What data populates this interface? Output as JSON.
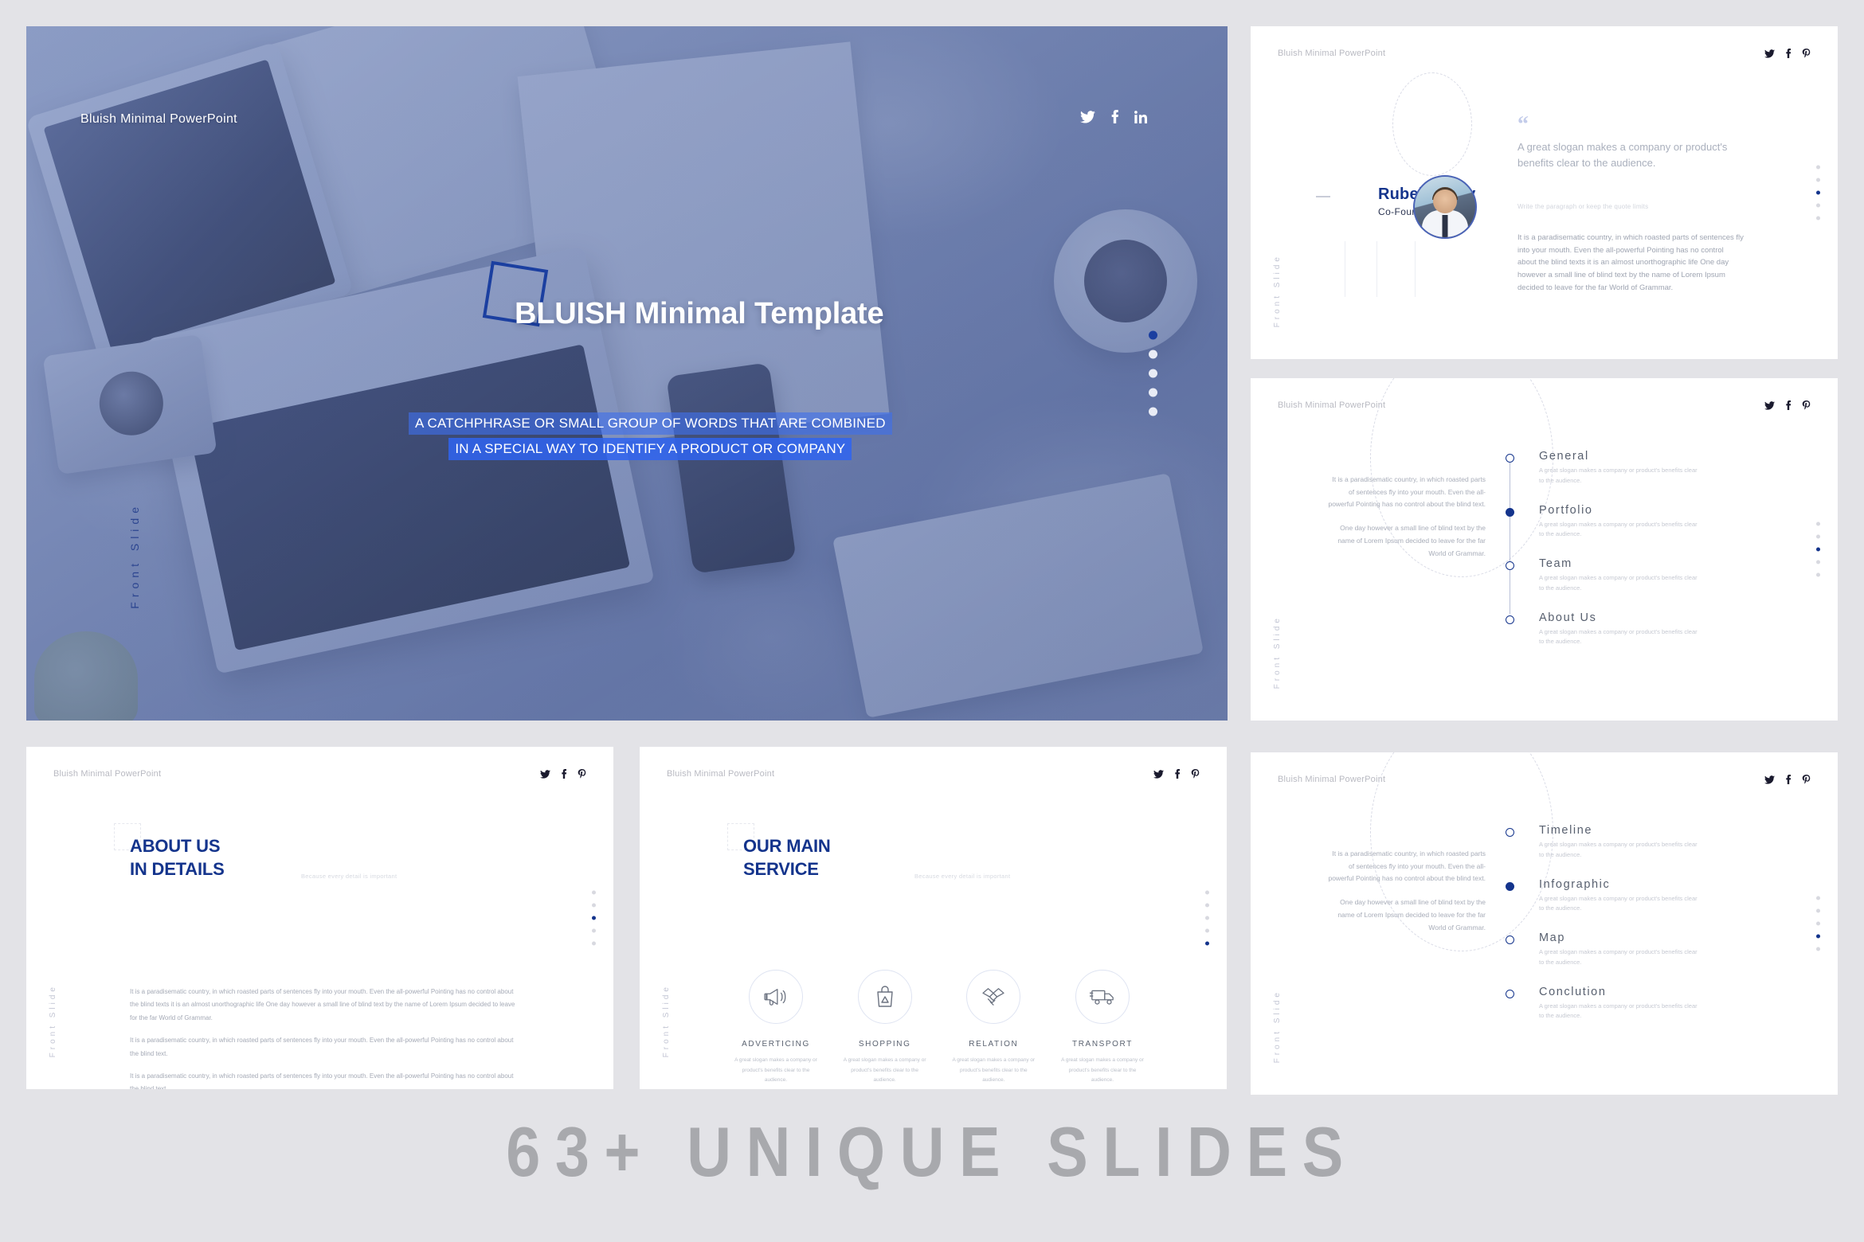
{
  "brand": "Bluish Minimal PowerPoint",
  "colors": {
    "accent": "#14348c",
    "accent_bright": "#1b3fa0",
    "highlight": "#3064f0",
    "page_bg": "#e3e3e7",
    "muted_text": "#a5aab6",
    "footer_text": "#a8a9ad"
  },
  "hero": {
    "brand": "Bluish Minimal PowerPoint",
    "title": "BLUISH Minimal Template",
    "subtitle_line1": "A CATCHPHRASE OR SMALL GROUP OF WORDS THAT ARE COMBINED",
    "subtitle_line2": "IN A SPECIAL WAY TO IDENTIFY A PRODUCT OR COMPANY",
    "side_label": "Front Slide",
    "socials": [
      "twitter-icon",
      "facebook-icon",
      "linkedin-icon"
    ],
    "dots": 5,
    "active_dot": 0
  },
  "slide_quote": {
    "brand": "Bluish Minimal PowerPoint",
    "person_name": "Rubel Mistry",
    "person_role": "Co-Founder, MNSK",
    "quote_mark": "“",
    "quote": "A great slogan makes a company or product's benefits clear to the audience.",
    "small_line": "Write the paragraph or keep the quote limits",
    "body": "It is a paradisematic country, in which roasted parts of sentences fly into your mouth. Even the all-powerful Pointing has no control about the blind texts it is an almost unorthographic life One day however a small line of blind text by the name of Lorem Ipsum decided to leave for the far World of Grammar.",
    "side_label": "Front Slide",
    "dots": 5,
    "active_dot": 2
  },
  "slide_menu_a": {
    "brand": "Bluish Minimal PowerPoint",
    "left_paragraphs": [
      "It is a paradisematic country, in which roasted parts of sentences fly into your mouth. Even the all-powerful Pointing has no control about the blind text.",
      "One day however a small line of blind text by the name of Lorem Ipsum decided to leave for the far World of Grammar."
    ],
    "items": [
      {
        "label": "General",
        "desc": "A great slogan makes a company or product's benefits clear to the audience.",
        "active": false
      },
      {
        "label": "Portfolio",
        "desc": "A great slogan makes a company or product's benefits clear to the audience.",
        "active": true
      },
      {
        "label": "Team",
        "desc": "A great slogan makes a company or product's benefits clear to the audience.",
        "active": false
      },
      {
        "label": "About Us",
        "desc": "A great slogan makes a company or product's benefits clear to the audience.",
        "active": false
      }
    ],
    "side_label": "Front Slide",
    "dots": 5,
    "active_dot": 2
  },
  "slide_menu_b": {
    "brand": "Bluish Minimal PowerPoint",
    "left_paragraphs": [
      "It is a paradisematic country, in which roasted parts of sentences fly into your mouth. Even the all-powerful Pointing has no control about the blind text.",
      "One day however a small line of blind text by the name of Lorem Ipsum decided to leave for the far World of Grammar."
    ],
    "items": [
      {
        "label": "Timeline",
        "desc": "A great slogan makes a company or product's benefits clear to the audience.",
        "active": false
      },
      {
        "label": "Infographic",
        "desc": "A great slogan makes a company or product's benefits clear to the audience.",
        "active": true
      },
      {
        "label": "Map",
        "desc": "A great slogan makes a company or product's benefits clear to the audience.",
        "active": false
      },
      {
        "label": "Conclution",
        "desc": "A great slogan makes a company or product's benefits clear to the audience.",
        "active": false
      }
    ],
    "side_label": "Front Slide",
    "dots": 5,
    "active_dot": 3
  },
  "slide_about": {
    "brand": "Bluish Minimal PowerPoint",
    "title_line1": "ABOUT US",
    "title_line2": "IN DETAILS",
    "title_hint": "Because every detail is important",
    "paragraphs": [
      "It is a paradisematic country, in which roasted parts of sentences fly into your mouth. Even the all-powerful Pointing has no control about the blind texts it is an almost unorthographic life One day however a small line of blind text by the name of Lorem Ipsum decided to leave for the far World of Grammar.",
      "It is a paradisematic country, in which roasted parts of sentences fly into your mouth. Even the all-powerful Pointing has no control about the blind text.",
      "It is a paradisematic country, in which roasted parts of sentences fly into your mouth. Even the all-powerful Pointing has no control about the blind text."
    ],
    "side_label": "Front Slide",
    "dots": 5,
    "active_dot": 2
  },
  "slide_service": {
    "brand": "Bluish Minimal PowerPoint",
    "title_line1": "OUR MAIN",
    "title_line2": "SERVICE",
    "title_hint": "Because every detail is important",
    "services": [
      {
        "icon": "megaphone-icon",
        "name": "ADVERTICING",
        "desc": "A great slogan makes a company or product's benefits clear to the audience."
      },
      {
        "icon": "shopping-bag-icon",
        "name": "SHOPPING",
        "desc": "A great slogan makes a company or product's benefits clear to the audience."
      },
      {
        "icon": "handshake-icon",
        "name": "RELATION",
        "desc": "A great slogan makes a company or product's benefits clear to the audience."
      },
      {
        "icon": "truck-icon",
        "name": "TRANSPORT",
        "desc": "A great slogan makes a company or product's benefits clear to the audience."
      }
    ],
    "side_label": "Front Slide",
    "dots": 5,
    "active_dot": 4
  },
  "footer": {
    "headline": "63+ UNIQUE SLIDES"
  }
}
